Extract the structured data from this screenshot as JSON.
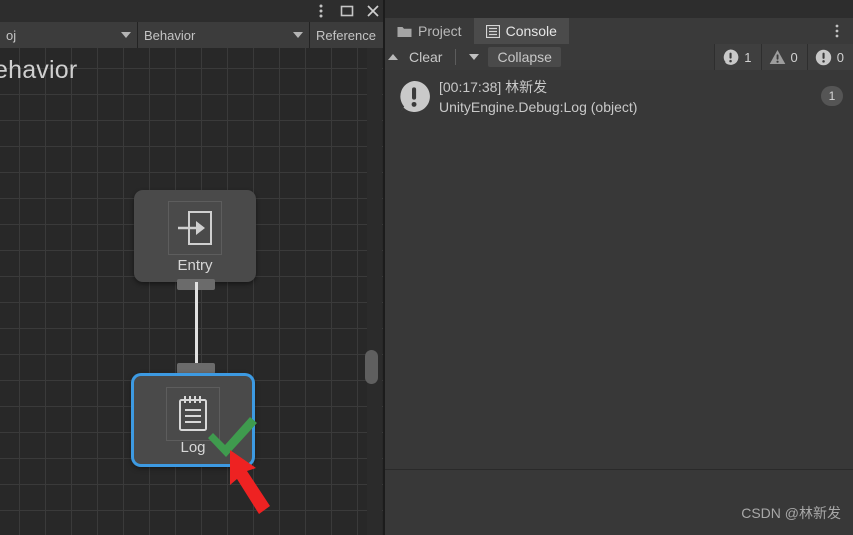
{
  "graph_panel": {
    "window_controls": [
      {
        "name": "more-options",
        "icon": "vertical-dots-icon"
      },
      {
        "name": "maximize",
        "icon": "maximize-icon"
      },
      {
        "name": "close",
        "icon": "close-icon"
      }
    ],
    "toolbar": {
      "dropdown_object": "oj",
      "dropdown_behavior": "Behavior",
      "dropdown_reference": "Reference"
    },
    "canvas_title": "ehavior",
    "nodes": [
      {
        "id": "entry",
        "label": "Entry",
        "icon": "enter-arrow-icon",
        "selected": false
      },
      {
        "id": "log",
        "label": "Log",
        "icon": "notepad-icon",
        "selected": true,
        "badge": "green-check-icon"
      }
    ],
    "edges": [
      {
        "from": "entry",
        "to": "log"
      }
    ]
  },
  "console_panel": {
    "tabs": [
      {
        "label": "Project",
        "icon": "folder-icon",
        "active": false
      },
      {
        "label": "Console",
        "icon": "list-lines-icon",
        "active": true
      }
    ],
    "options_icon": "vertical-dots-icon",
    "toolbar": {
      "clear_label": "Clear",
      "clear_caret": "chevron-down-icon",
      "collapse_label": "Collapse"
    },
    "counters": [
      {
        "icon": "log-bubble-icon",
        "value": "1"
      },
      {
        "icon": "warning-triangle-icon",
        "value": "0"
      },
      {
        "icon": "error-circle-icon",
        "value": "0"
      }
    ],
    "log_entries": [
      {
        "icon": "log-bubble-icon",
        "line1": "[00:17:38] 林新发",
        "line2": "UnityEngine.Debug:Log (object)",
        "count": "1"
      }
    ]
  },
  "watermark": "CSDN @林新发",
  "annotations": [
    {
      "name": "arrow-to-console-log",
      "color": "#ee2222",
      "direction": "up"
    },
    {
      "name": "arrow-to-log-node",
      "color": "#ee2222",
      "direction": "up-left"
    }
  ],
  "colors": {
    "selection": "#3d9ae2",
    "check": "#3f9b4e",
    "annotation": "#ee2222",
    "panel_bg": "#383838",
    "canvas_bg": "#282828"
  }
}
